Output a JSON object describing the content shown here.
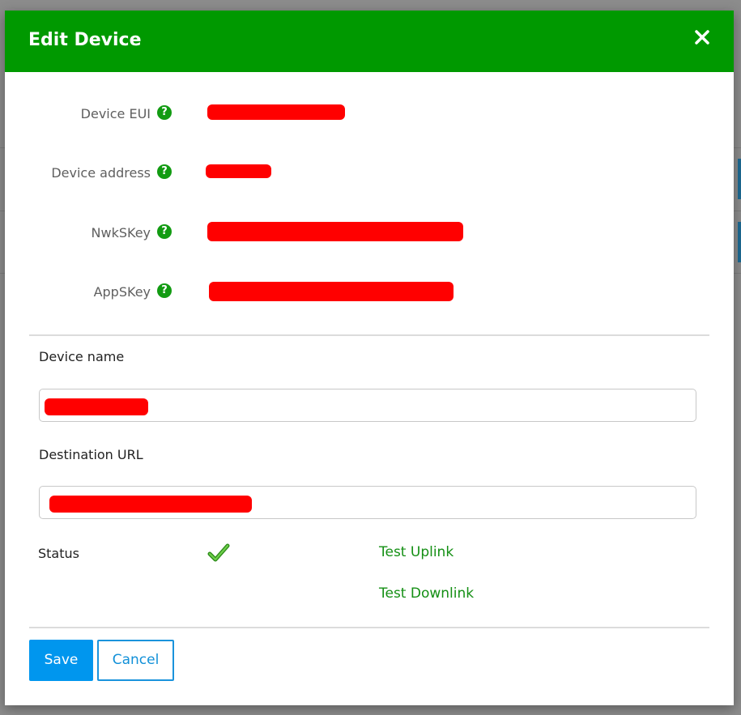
{
  "dialog": {
    "title": "Edit Device",
    "close_icon": "close-icon",
    "header_color": "#009900"
  },
  "device_info": [
    {
      "label": "Device EUI",
      "icon": "help-icon",
      "value_redacted": true
    },
    {
      "label": "Device address",
      "icon": "help-icon",
      "value_redacted": true
    },
    {
      "label": "NwkSKey",
      "icon": "help-icon",
      "value_redacted": true
    },
    {
      "label": "AppSKey",
      "icon": "help-icon",
      "value_redacted": true
    }
  ],
  "form": {
    "device_name_label": "Device name",
    "destination_url_label": "Destination URL",
    "status_label": "Status",
    "status_icon": "checkmark-icon",
    "test_uplink": "Test Uplink",
    "test_downlink": "Test Downlink"
  },
  "buttons": {
    "save": "Save",
    "cancel": "Cancel"
  },
  "colors": {
    "accent_green": "#009900",
    "link_green": "#148f14",
    "primary_blue": "#0096ee",
    "redaction": "#ff0000"
  }
}
